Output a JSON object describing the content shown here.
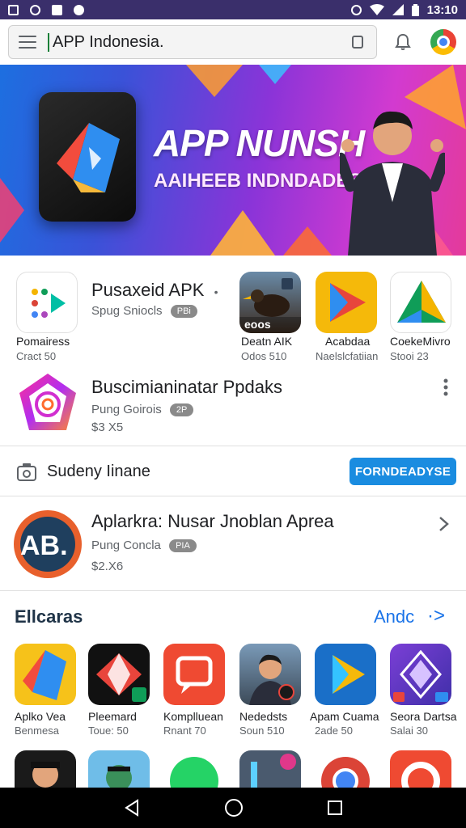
{
  "status_bar": {
    "time": "13:10",
    "left_icons": [
      "gallery-icon",
      "whatsapp-icon",
      "bag-icon",
      "dot-icon"
    ],
    "right_icons": [
      "alarm-icon",
      "wifi-icon",
      "signal-icon",
      "battery-icon"
    ]
  },
  "search": {
    "text": "APP Indonesia."
  },
  "banner": {
    "title": "APP NUNSH",
    "subtitle": "AAIHEEB INDNDADESIA"
  },
  "featured": {
    "main": {
      "title": "Pusaxeid APK",
      "dot": "•",
      "sub": "Spug Sniocls",
      "badge": "PBi"
    },
    "tiles": [
      {
        "label": "Pomairess",
        "sub": "Cract 50"
      },
      {
        "label": "Deatn AIK",
        "sub": "Odos 510",
        "inner_text": "eoos"
      },
      {
        "label": "Acabdaa",
        "sub": "Naelslcfatiian"
      },
      {
        "label": "CoekeMivro",
        "sub": "Stooi 23"
      }
    ]
  },
  "listing_one": {
    "title": "Buscimianinatar Ppdaks",
    "sub": "Pung Goirois",
    "badge": "2P",
    "price": "$3 X5"
  },
  "install_row": {
    "label": "Sudeny Iinane",
    "button": "FORNDEADYSE"
  },
  "listing_two": {
    "title": "Aplarkra: Nusar Jnoblan Aprea",
    "sub": "Pung Concla",
    "badge": "PIA",
    "price": "$2.X6",
    "icon_text": "AB."
  },
  "section": {
    "title": "Ellcaras",
    "link": "Andc",
    "arrow": "·>"
  },
  "grid": [
    {
      "label": "Aplko Vea",
      "sub": "Benmesa"
    },
    {
      "label": "Pleemard",
      "sub": "Toue: 50"
    },
    {
      "label": "Komplluean",
      "sub": "Rnant 70"
    },
    {
      "label": "Nededsts",
      "sub": "Soun 510"
    },
    {
      "label": "Apam Cuama",
      "sub": "2ade 50"
    },
    {
      "label": "Seora Dartsa",
      "sub": "Salai 30"
    }
  ],
  "colors": {
    "status_bar": "#3a2f6b",
    "accent_blue": "#1a8ce0",
    "link_blue": "#1a73e8"
  }
}
